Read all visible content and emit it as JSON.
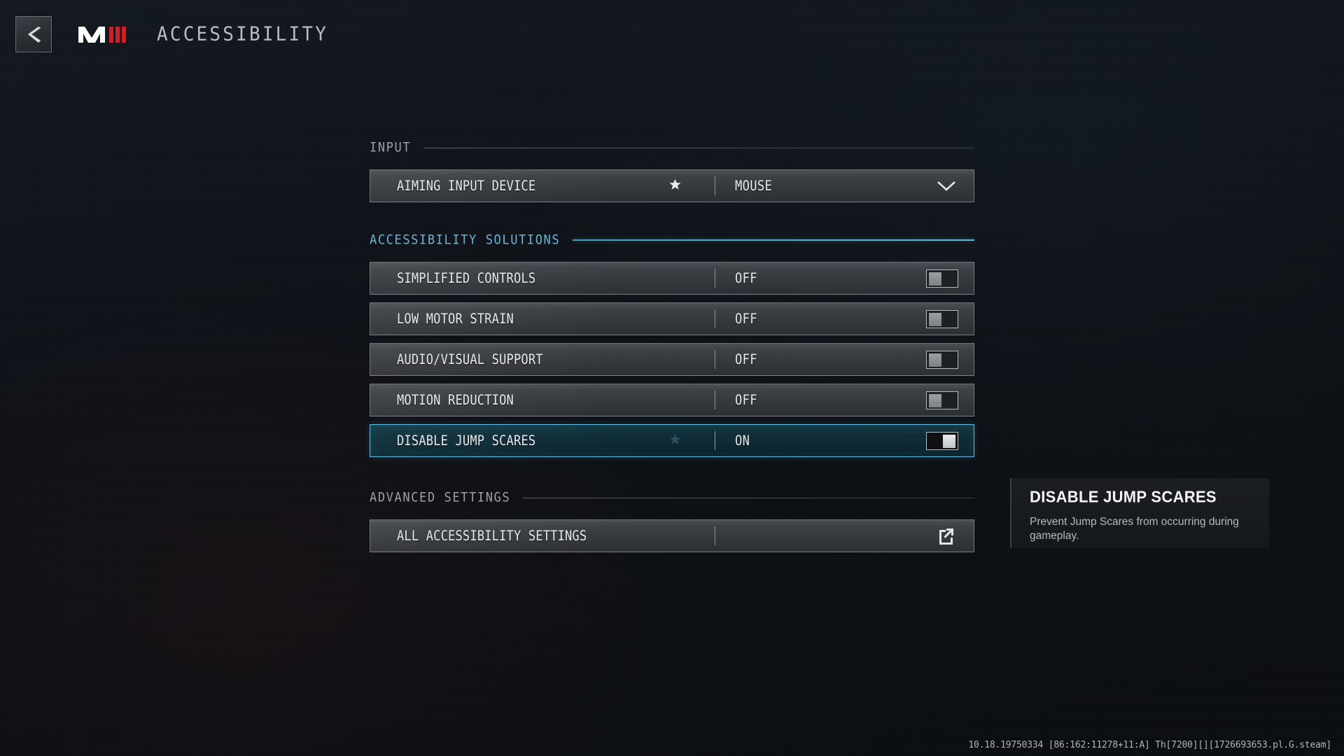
{
  "header": {
    "back_label": "Back",
    "back_icon": "chevron-left-icon",
    "logo_text": "MWIII",
    "title": "ACCESSIBILITY"
  },
  "sections": [
    {
      "id": "input",
      "label": "INPUT",
      "accent": false,
      "rows": [
        {
          "id": "aiming-input-device",
          "label": "AIMING INPUT DEVICE",
          "value": "MOUSE",
          "control": "dropdown",
          "control_icon": "chevron-down-icon",
          "star": true,
          "selected": false
        }
      ]
    },
    {
      "id": "accessibility-solutions",
      "label": "ACCESSIBILITY SOLUTIONS",
      "accent": true,
      "rows": [
        {
          "id": "simplified-controls",
          "label": "SIMPLIFIED CONTROLS",
          "value": "OFF",
          "control": "toggle",
          "toggle_state": "off",
          "star": false,
          "selected": false
        },
        {
          "id": "low-motor-strain",
          "label": "LOW MOTOR STRAIN",
          "value": "OFF",
          "control": "toggle",
          "toggle_state": "off",
          "star": false,
          "selected": false
        },
        {
          "id": "audio-visual-support",
          "label": "AUDIO/VISUAL SUPPORT",
          "value": "OFF",
          "control": "toggle",
          "toggle_state": "off",
          "star": false,
          "selected": false
        },
        {
          "id": "motion-reduction",
          "label": "MOTION REDUCTION",
          "value": "OFF",
          "control": "toggle",
          "toggle_state": "off",
          "star": false,
          "selected": false
        },
        {
          "id": "disable-jump-scares",
          "label": "DISABLE JUMP SCARES",
          "value": "ON",
          "control": "toggle",
          "toggle_state": "on",
          "star": true,
          "selected": true
        }
      ]
    },
    {
      "id": "advanced-settings",
      "label": "ADVANCED SETTINGS",
      "accent": false,
      "rows": [
        {
          "id": "all-accessibility-settings",
          "label": "ALL ACCESSIBILITY SETTINGS",
          "value": "",
          "control": "external-link",
          "control_icon": "external-link-icon",
          "star": false,
          "selected": false
        }
      ]
    }
  ],
  "tooltip": {
    "title": "DISABLE JUMP SCARES",
    "body": "Prevent Jump Scares from occurring during gameplay."
  },
  "build_string": "10.18.19750334 [86:162:11278+11:A] Th[7200][][1726693653.pl.G.steam]",
  "colors": {
    "accent_cyan": "#63b6d9",
    "selected_border": "#63c2e4",
    "logo_red": "#cf1f27",
    "background": "#0c1014",
    "text_primary": "#e8eaec",
    "text_muted": "#9aa0a6"
  }
}
